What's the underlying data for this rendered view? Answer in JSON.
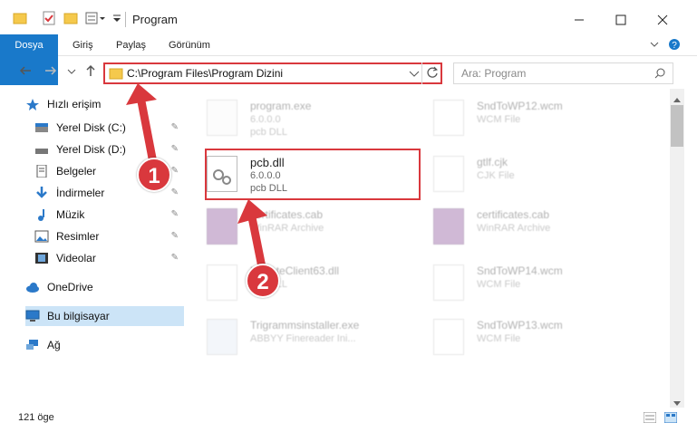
{
  "window": {
    "title": "Program"
  },
  "ribbon": {
    "tabs": [
      "Dosya",
      "Giriş",
      "Paylaş",
      "Görünüm"
    ]
  },
  "address": {
    "path": "C:\\Program Files\\Program Dizini"
  },
  "search": {
    "placeholder": "Ara: Program"
  },
  "sidebar": {
    "items": [
      {
        "label": "Hızlı erişim"
      },
      {
        "label": "Yerel Disk (C:)"
      },
      {
        "label": "Yerel Disk (D:)"
      },
      {
        "label": "Belgeler"
      },
      {
        "label": "İndirmeler"
      },
      {
        "label": "Müzik"
      },
      {
        "label": "Resimler"
      },
      {
        "label": "Videolar"
      },
      {
        "label": "OneDrive"
      },
      {
        "label": "Bu bilgisayar"
      },
      {
        "label": "Ağ"
      }
    ]
  },
  "files": [
    {
      "name": "program.exe",
      "sub1": "6.0.0.0",
      "sub2": "pcb DLL"
    },
    {
      "name": "SndToWP12.wcm",
      "sub1": "WCM File",
      "sub2": ""
    },
    {
      "name": "pcb.dll",
      "sub1": "6.0.0.0",
      "sub2": "pcb DLL"
    },
    {
      "name": "gtlf.cjk",
      "sub1": "CJK File",
      "sub2": ""
    },
    {
      "name": "certificates.cab",
      "sub1": "WinRAR Archive",
      "sub2": ""
    },
    {
      "name": "certificates.cab",
      "sub1": "WinRAR Archive",
      "sub2": ""
    },
    {
      "name": "UpdateClient63.dll",
      "sub1": "pcb DLL",
      "sub2": ""
    },
    {
      "name": "SndToWP14.wcm",
      "sub1": "WCM File",
      "sub2": ""
    },
    {
      "name": "Trigrammsinstaller.exe",
      "sub1": "ABBYY Finereader Ini...",
      "sub2": ""
    },
    {
      "name": "SndToWP13.wcm",
      "sub1": "WCM File",
      "sub2": ""
    }
  ],
  "status": {
    "count": "121 öge"
  },
  "callouts": [
    "1",
    "2"
  ],
  "colors": {
    "accent": "#1979ca",
    "highlight": "#d9383d"
  }
}
